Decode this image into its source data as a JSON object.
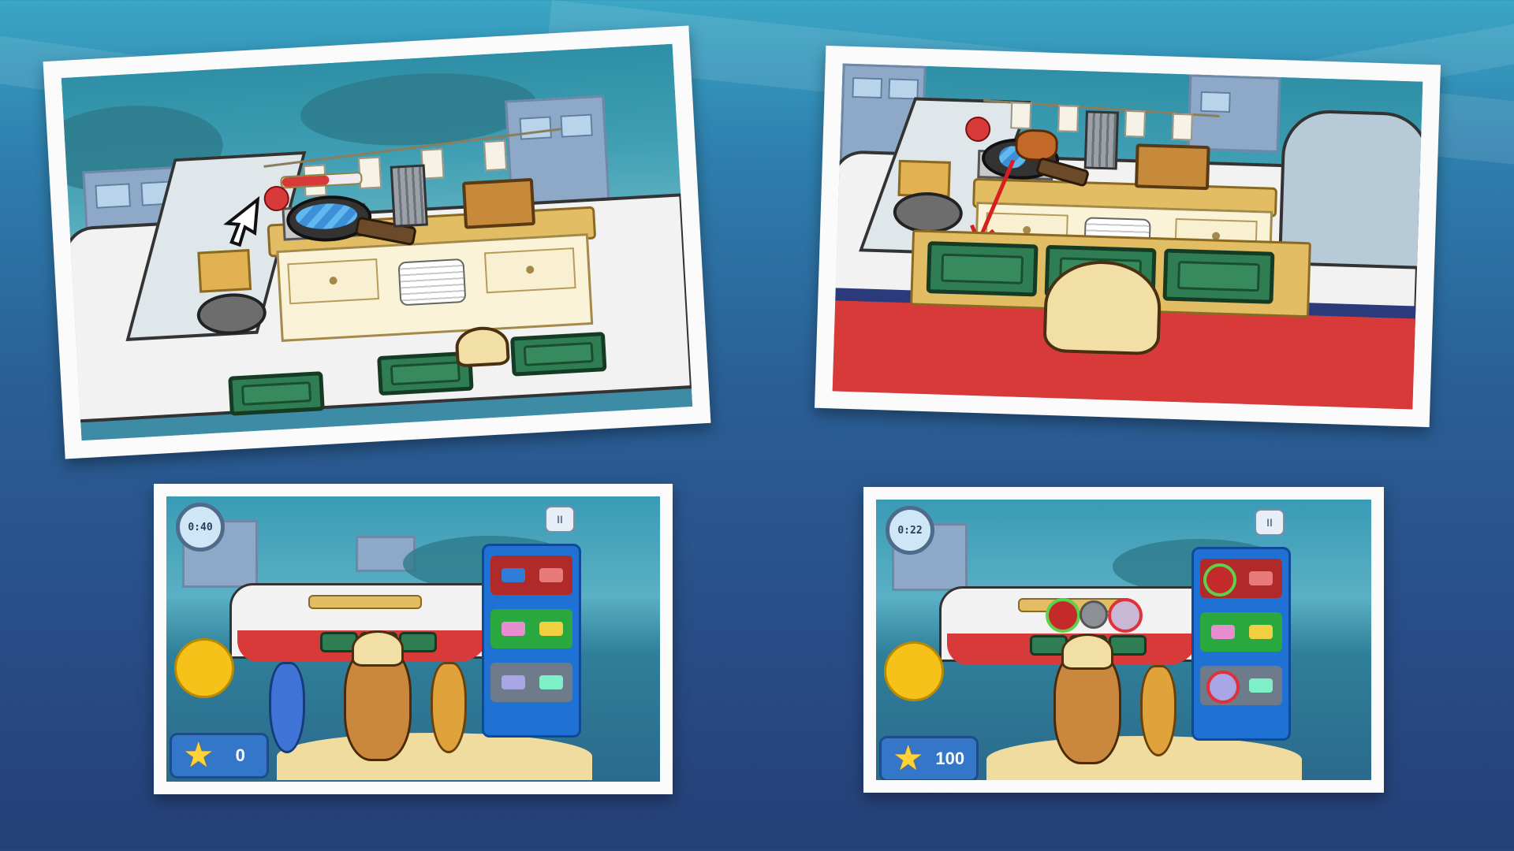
{
  "screens": [
    {
      "id": "zoom-stove",
      "desc": ""
    },
    {
      "id": "zoom-tray",
      "desc": ""
    },
    {
      "id": "gameplay-1",
      "timer": "0:40",
      "score": "0"
    },
    {
      "id": "gameplay-2",
      "timer": "0:22",
      "score": "100"
    }
  ],
  "icons": {
    "pause": "II",
    "star": "★",
    "close": "✕"
  },
  "colors": {
    "accent_red": "#d83a3a",
    "tray_green": "#2f7d52",
    "panel_blue": "#1f72d4",
    "ring_green": "#5ed04a",
    "ring_red": "#e0303a"
  }
}
